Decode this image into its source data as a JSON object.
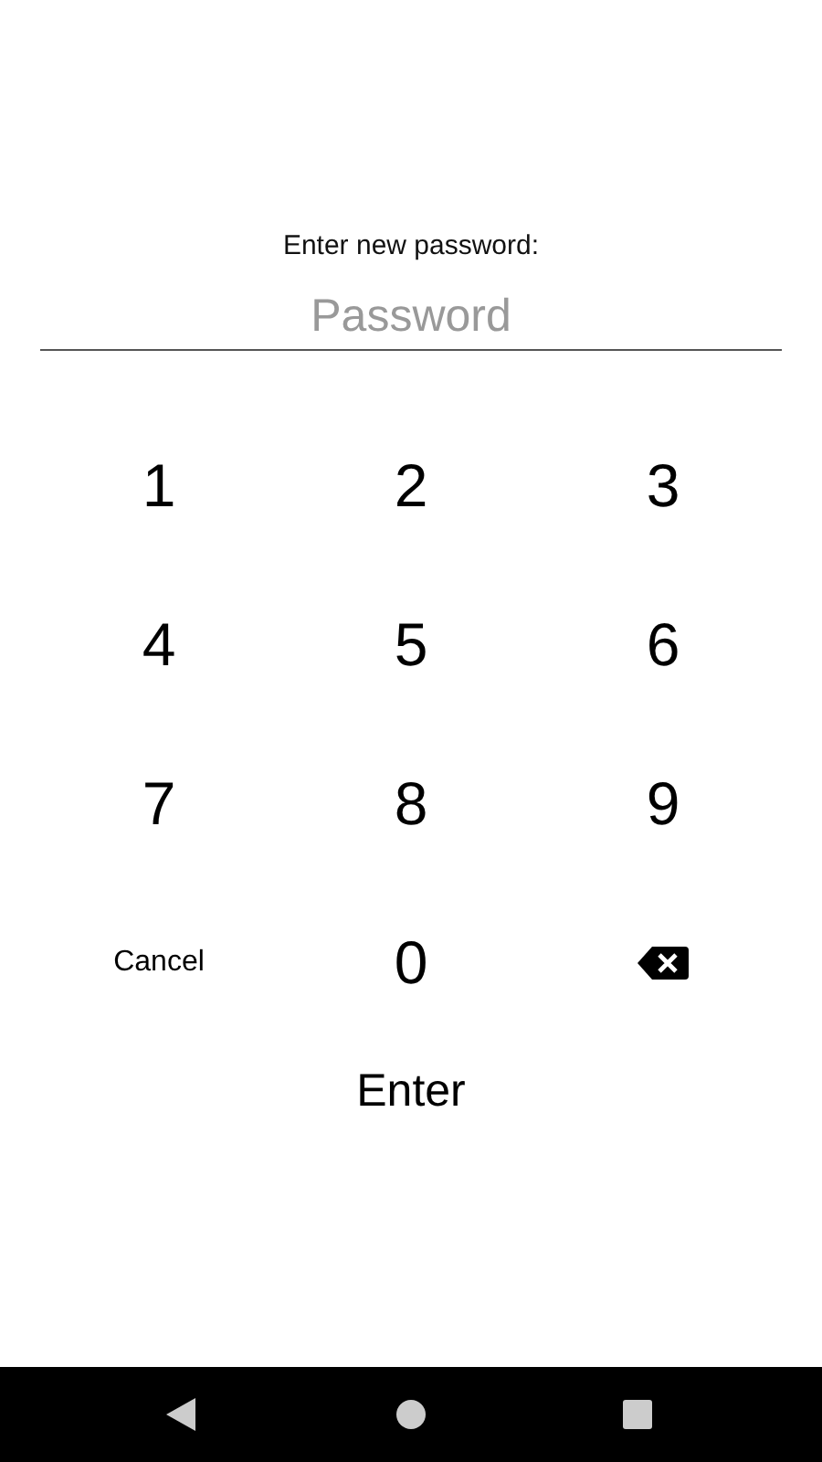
{
  "prompt": "Enter new password:",
  "password_field": {
    "placeholder": "Password"
  },
  "keys": [
    {
      "kind": "digit",
      "label": "1"
    },
    {
      "kind": "digit",
      "label": "2"
    },
    {
      "kind": "digit",
      "label": "3"
    },
    {
      "kind": "digit",
      "label": "4"
    },
    {
      "kind": "digit",
      "label": "5"
    },
    {
      "kind": "digit",
      "label": "6"
    },
    {
      "kind": "digit",
      "label": "7"
    },
    {
      "kind": "digit",
      "label": "8"
    },
    {
      "kind": "digit",
      "label": "9"
    },
    {
      "kind": "text",
      "label": "Cancel"
    },
    {
      "kind": "digit",
      "label": "0"
    },
    {
      "kind": "backspace"
    }
  ],
  "enter_button": "Enter"
}
